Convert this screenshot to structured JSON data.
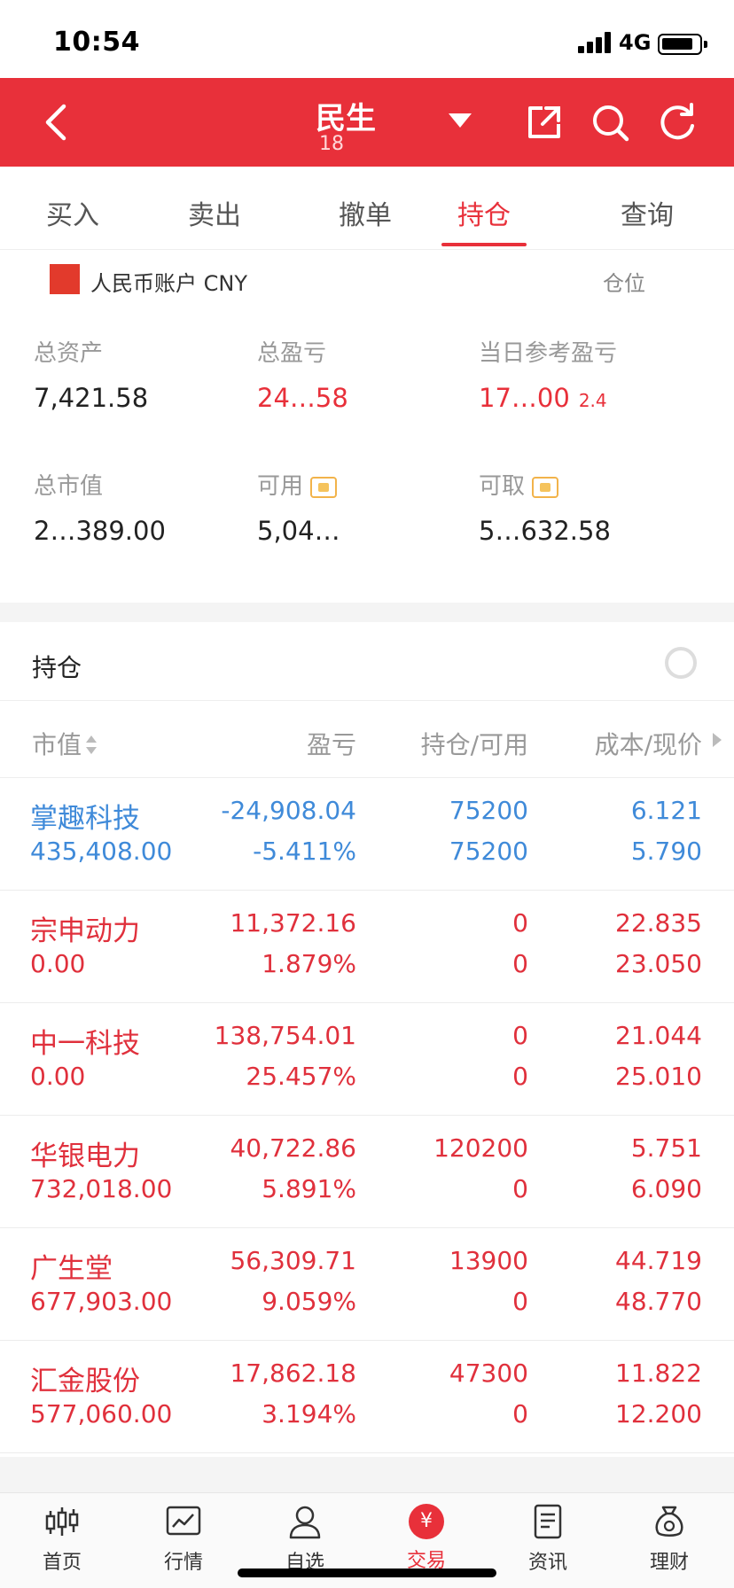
{
  "status_bar": {
    "time": "10:54",
    "network": "4G"
  },
  "header": {
    "title": "民生",
    "subtitle": "18"
  },
  "tabs": [
    {
      "label": "买入"
    },
    {
      "label": "卖出"
    },
    {
      "label": "撤单"
    },
    {
      "label": "持仓",
      "active": true
    },
    {
      "label": "查询"
    }
  ],
  "account": {
    "name": "人民币账户 CNY",
    "right": "仓位"
  },
  "stats": {
    "total_assets": {
      "label": "总资产",
      "value": "7,421.58"
    },
    "total_pl": {
      "label": "总盈亏",
      "value": "24…58"
    },
    "daily_pl": {
      "label": "当日参考盈亏",
      "value": "17…00",
      "pct": "2.4"
    },
    "market_value": {
      "label": "总市值",
      "value": "2…389.00"
    },
    "available": {
      "label": "可用",
      "value": "5,04…"
    },
    "withdrawable": {
      "label": "可取",
      "value": "5…632.58"
    }
  },
  "holdings": {
    "title": "持仓",
    "columns": {
      "market_value": "市值",
      "pl": "盈亏",
      "position": "持仓/可用",
      "cost": "成本/现价"
    },
    "rows": [
      {
        "name": "掌趣科技",
        "market_value": "435,408.00",
        "pl": "-24,908.04",
        "pl_ratio": "-5.411%",
        "position": "75200",
        "available": "75200",
        "cost": "6.121",
        "price": "5.790",
        "tone": "blue"
      },
      {
        "name": "宗申动力",
        "market_value": "0.00",
        "pl": "11,372.16",
        "pl_ratio": "1.879%",
        "position": "0",
        "available": "0",
        "cost": "22.835",
        "price": "23.050",
        "tone": "red"
      },
      {
        "name": "中一科技",
        "market_value": "0.00",
        "pl": "138,754.01",
        "pl_ratio": "25.457%",
        "position": "0",
        "available": "0",
        "cost": "21.044",
        "price": "25.010",
        "tone": "red"
      },
      {
        "name": "华银电力",
        "market_value": "732,018.00",
        "pl": "40,722.86",
        "pl_ratio": "5.891%",
        "position": "120200",
        "available": "0",
        "cost": "5.751",
        "price": "6.090",
        "tone": "red"
      },
      {
        "name": "广生堂",
        "market_value": "677,903.00",
        "pl": "56,309.71",
        "pl_ratio": "9.059%",
        "position": "13900",
        "available": "0",
        "cost": "44.719",
        "price": "48.770",
        "tone": "red"
      },
      {
        "name": "汇金股份",
        "market_value": "577,060.00",
        "pl": "17,862.18",
        "pl_ratio": "3.194%",
        "position": "47300",
        "available": "0",
        "cost": "11.822",
        "price": "12.200",
        "tone": "red"
      }
    ]
  },
  "nav": [
    {
      "label": "首页",
      "icon": "candlestick-icon"
    },
    {
      "label": "行情",
      "icon": "trend-chart-icon"
    },
    {
      "label": "自选",
      "icon": "user-star-icon"
    },
    {
      "label": "交易",
      "icon": "yuan-coin-icon",
      "symbol": "¥",
      "active": true
    },
    {
      "label": "资讯",
      "icon": "document-icon"
    },
    {
      "label": "理财",
      "icon": "money-bag-icon"
    }
  ],
  "colors": {
    "brand_red": "#e8303a",
    "loss_blue": "#3f8ad9",
    "gain_red": "#e0303c"
  }
}
